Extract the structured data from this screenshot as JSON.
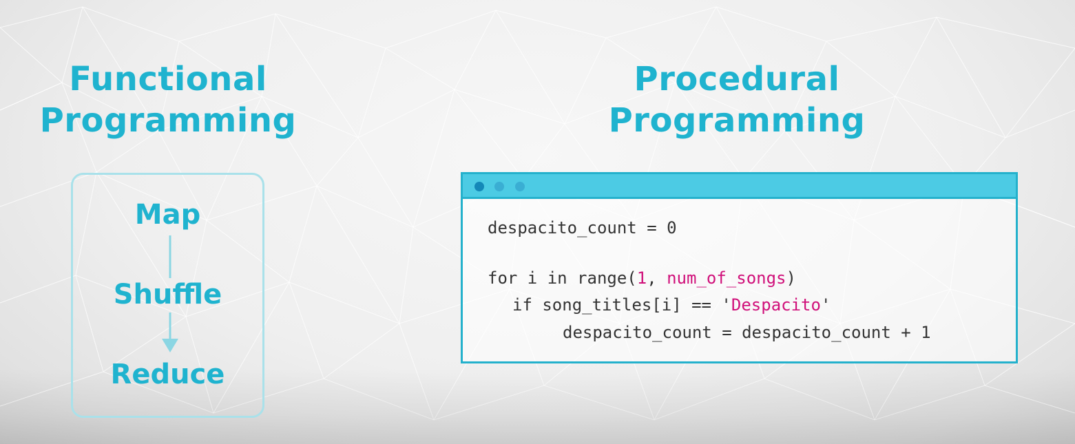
{
  "colors": {
    "title": "#1fb3cf",
    "flow_text": "#1fb3cf",
    "flow_border": "#a9e1ea",
    "flow_line": "#8bd6e3",
    "window_border": "#24b1cc",
    "window_bar": "#4ccbe4",
    "window_dot_1": "#1488b8",
    "window_dot_2": "#3aaed3",
    "window_dot_3": "#3aaed3",
    "code_text": "#333333",
    "code_highlight": "#d0107a"
  },
  "functional": {
    "title_line1": "Functional",
    "title_line2": "Programming",
    "steps": [
      "Map",
      "Shuffle",
      "Reduce"
    ]
  },
  "procedural": {
    "title_line1": "Procedural",
    "title_line2": "Programming",
    "code": {
      "line1": "despacito_count = 0",
      "line2_a": "for i in range(",
      "line2_num": "1",
      "line2_b": ", ",
      "line2_var": "num_of_songs",
      "line2_c": ")",
      "line3_a": "if song_titles[i] == '",
      "line3_str": "Despacito",
      "line3_b": "'",
      "line4": "despacito_count = despacito_count + 1"
    }
  }
}
